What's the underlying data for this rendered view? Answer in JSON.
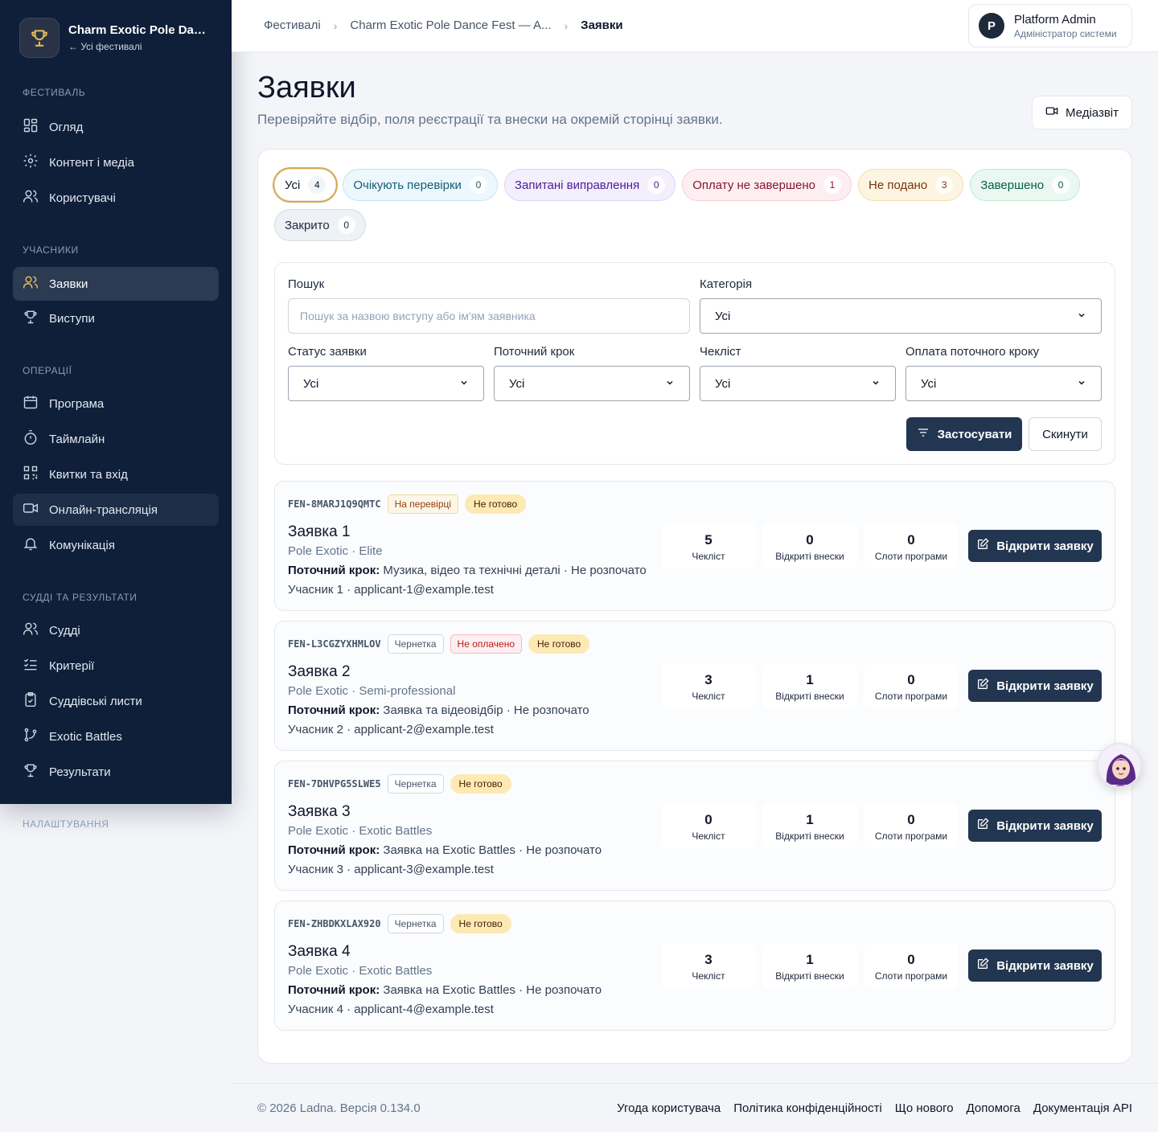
{
  "sidebar": {
    "brand_name": "Charm Exotic Pole Dance Fest — Autumn",
    "back_label": "← Усі фестивалі",
    "sections": {
      "festival": "Фестиваль",
      "participants": "Учасники",
      "operations": "Операції",
      "judges": "Судді та результати",
      "settings": "Налаштування"
    },
    "items": {
      "overview": "Огляд",
      "content": "Контент і медіа",
      "users": "Користувачі",
      "applications": "Заявки",
      "performances": "Виступи",
      "program": "Програма",
      "timeline": "Таймлайн",
      "tickets": "Квитки та вхід",
      "stream": "Онлайн-трансляція",
      "communication": "Комунікація",
      "judges": "Судді",
      "criteria": "Критерії",
      "score_sheets": "Суддівські листи",
      "battles": "Exotic Battles",
      "results": "Результати"
    }
  },
  "header": {
    "breadcrumbs": [
      "Фестивалі",
      "Charm Exotic Pole Dance Fest — A...",
      "Заявки"
    ],
    "user_initial": "P",
    "user_name": "Platform Admin",
    "user_role": "Адміністратор системи"
  },
  "page": {
    "title": "Заявки",
    "subtitle": "Перевіряйте відбір, поля реєстрації та внески на окремій сторінці заявки.",
    "media_button": "Медіазвіт"
  },
  "tabs": [
    {
      "label": "Усі",
      "count": "4"
    },
    {
      "label": "Очікують перевірки",
      "count": "0"
    },
    {
      "label": "Запитані виправлення",
      "count": "0"
    },
    {
      "label": "Оплату не завершено",
      "count": "1"
    },
    {
      "label": "Не подано",
      "count": "3"
    },
    {
      "label": "Завершено",
      "count": "0"
    },
    {
      "label": "Закрито",
      "count": "0"
    }
  ],
  "filters": {
    "search_label": "Пошук",
    "search_placeholder": "Пошук за назвою виступу або ім'ям заявника",
    "category_label": "Категорія",
    "category_value": "Усі",
    "status_label": "Статус заявки",
    "status_value": "Усі",
    "step_label": "Поточний крок",
    "step_value": "Усі",
    "checklist_label": "Чекліст",
    "checklist_value": "Усі",
    "payment_label": "Оплата поточного кроку",
    "payment_value": "Усі",
    "apply_label": "Застосувати",
    "reset_label": "Скинути"
  },
  "labels": {
    "current_step": "Поточний крок:",
    "stat_checklist": "Чекліст",
    "stat_contributions": "Відкриті внески",
    "stat_slots": "Слоти програми",
    "open_button": "Відкрити заявку"
  },
  "applications": [
    {
      "code": "FEN-8MARJ1Q9QMTC",
      "badges": [
        "На перевірці",
        "Не готово"
      ],
      "title": "Заявка 1",
      "category": "Pole Exotic · Elite",
      "step": "Музика, відео та технічні деталі · Не розпочато",
      "user": "Учасник 1 · applicant-1@example.test",
      "checklist": "5",
      "contributions": "0",
      "slots": "0"
    },
    {
      "code": "FEN-L3CGZYXHMLOV",
      "badges": [
        "Чернетка",
        "Не оплачено",
        "Не готово"
      ],
      "title": "Заявка 2",
      "category": "Pole Exotic · Semi-professional",
      "step": "Заявка та відеовідбір · Не розпочато",
      "user": "Учасник 2 · applicant-2@example.test",
      "checklist": "3",
      "contributions": "1",
      "slots": "0"
    },
    {
      "code": "FEN-7DHVPG5SLWE5",
      "badges": [
        "Чернетка",
        "Не готово"
      ],
      "title": "Заявка 3",
      "category": "Pole Exotic · Exotic Battles",
      "step": "Заявка на Exotic Battles · Не розпочато",
      "user": "Учасник 3 · applicant-3@example.test",
      "checklist": "0",
      "contributions": "1",
      "slots": "0"
    },
    {
      "code": "FEN-ZHBDKXLAX920",
      "badges": [
        "Чернетка",
        "Не готово"
      ],
      "title": "Заявка 4",
      "category": "Pole Exotic · Exotic Battles",
      "step": "Заявка на Exotic Battles · Не розпочато",
      "user": "Учасник 4 · applicant-4@example.test",
      "checklist": "3",
      "contributions": "1",
      "slots": "0"
    }
  ],
  "footer": {
    "copyright": "© 2026 Ladna. Версія 0.134.0",
    "links": [
      "Угода користувача",
      "Політика конфіденційності",
      "Що нового",
      "Допомога",
      "Документація API"
    ]
  },
  "colors": {
    "sidebar_bg": "#0f1f3a",
    "primary_button": "#223652",
    "active_tab_ring": "#d9a84a",
    "brand_icon": "#e8c15a"
  }
}
